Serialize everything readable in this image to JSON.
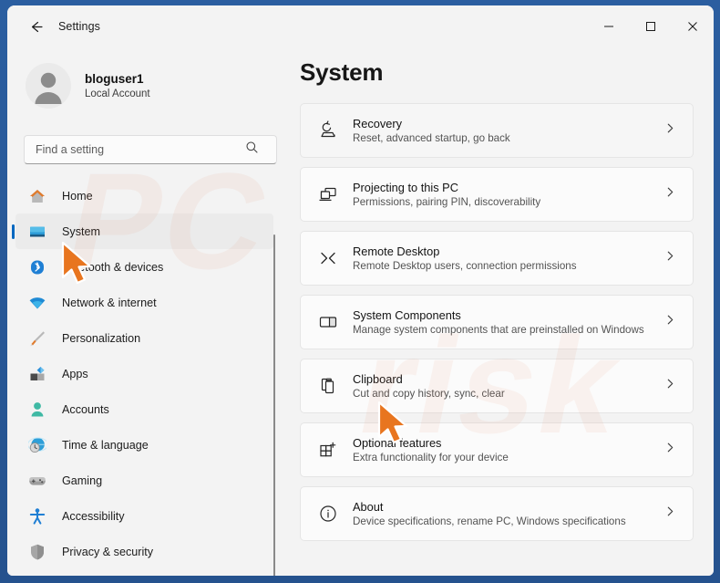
{
  "window": {
    "title": "Settings",
    "back_icon": "back-arrow-icon",
    "controls": {
      "minimize": "minimize-icon",
      "maximize": "maximize-icon",
      "close": "close-icon"
    },
    "accent_color": "#0067c0",
    "frame_color": "#2b5ea0",
    "background": "#f3f3f3"
  },
  "account": {
    "name": "bloguser1",
    "type": "Local Account",
    "avatar_icon": "person-avatar-icon"
  },
  "search": {
    "placeholder": "Find a setting",
    "value": "",
    "icon": "search-icon"
  },
  "sidebar": {
    "items": [
      {
        "label": "Home",
        "icon": "home-icon",
        "selected": false
      },
      {
        "label": "System",
        "icon": "monitor-icon",
        "selected": true
      },
      {
        "label": "Bluetooth & devices",
        "icon": "bluetooth-icon",
        "selected": false
      },
      {
        "label": "Network & internet",
        "icon": "wifi-icon",
        "selected": false
      },
      {
        "label": "Personalization",
        "icon": "paintbrush-icon",
        "selected": false
      },
      {
        "label": "Apps",
        "icon": "apps-blocks-icon",
        "selected": false
      },
      {
        "label": "Accounts",
        "icon": "account-person-icon",
        "selected": false
      },
      {
        "label": "Time & language",
        "icon": "globe-clock-icon",
        "selected": false
      },
      {
        "label": "Gaming",
        "icon": "gamepad-icon",
        "selected": false
      },
      {
        "label": "Accessibility",
        "icon": "accessibility-person-icon",
        "selected": false
      },
      {
        "label": "Privacy & security",
        "icon": "shield-icon",
        "selected": false
      }
    ]
  },
  "main": {
    "page_title": "System",
    "chevron_icon": "chevron-right-icon",
    "cards": [
      {
        "title": "Recovery",
        "subtitle": "Reset, advanced startup, go back",
        "icon": "recovery-icon",
        "hovered": true
      },
      {
        "title": "Projecting to this PC",
        "subtitle": "Permissions, pairing PIN, discoverability",
        "icon": "projecting-screens-icon",
        "hovered": false
      },
      {
        "title": "Remote Desktop",
        "subtitle": "Remote Desktop users, connection permissions",
        "icon": "remote-desktop-icon",
        "hovered": false
      },
      {
        "title": "System Components",
        "subtitle": "Manage system components that are preinstalled on Windows",
        "icon": "system-components-icon",
        "hovered": false
      },
      {
        "title": "Clipboard",
        "subtitle": "Cut and copy history, sync, clear",
        "icon": "clipboard-icon",
        "hovered": false
      },
      {
        "title": "Optional features",
        "subtitle": "Extra functionality for your device",
        "icon": "optional-features-icon",
        "hovered": false
      },
      {
        "title": "About",
        "subtitle": "Device specifications, rename PC, Windows specifications",
        "icon": "info-circle-icon",
        "hovered": false
      }
    ]
  },
  "watermark": {
    "text_a": "PC",
    "text_b": "risk"
  },
  "cursors": {
    "sidebar_target": "System",
    "main_target": "Clipboard",
    "color": "#e8751f"
  }
}
